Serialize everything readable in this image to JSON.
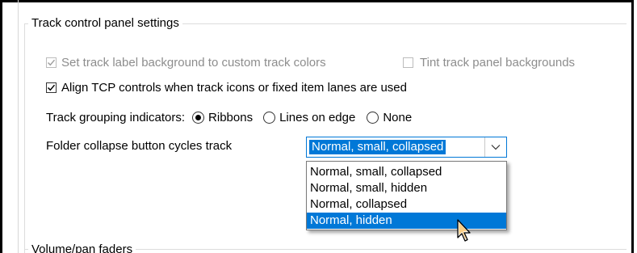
{
  "group_track_control": {
    "title": "Track control panel settings"
  },
  "checkboxes": {
    "set_label_bg": {
      "label": "Set track label background to custom track colors",
      "checked": true,
      "enabled": false
    },
    "tint_panel": {
      "label": "Tint track panel backgrounds",
      "checked": false,
      "enabled": false
    },
    "align_tcp": {
      "label": "Align TCP controls when track icons or fixed item lanes are used",
      "checked": true,
      "enabled": true
    }
  },
  "grouping": {
    "label": "Track grouping indicators:",
    "options": [
      {
        "label": "Ribbons",
        "selected": true
      },
      {
        "label": "Lines on edge",
        "selected": false
      },
      {
        "label": "None",
        "selected": false
      }
    ]
  },
  "folder_collapse": {
    "label": "Folder collapse button cycles track",
    "selected_value": "Normal, small, collapsed",
    "options": [
      "Normal, small, collapsed",
      "Normal, small, hidden",
      "Normal, collapsed",
      "Normal, hidden"
    ],
    "highlighted_option": "Normal, hidden"
  },
  "group_volume_pan": {
    "title": "Volume/pan faders"
  },
  "colors": {
    "accent": "#0078d7",
    "disabled_text": "#8d8d8d"
  }
}
